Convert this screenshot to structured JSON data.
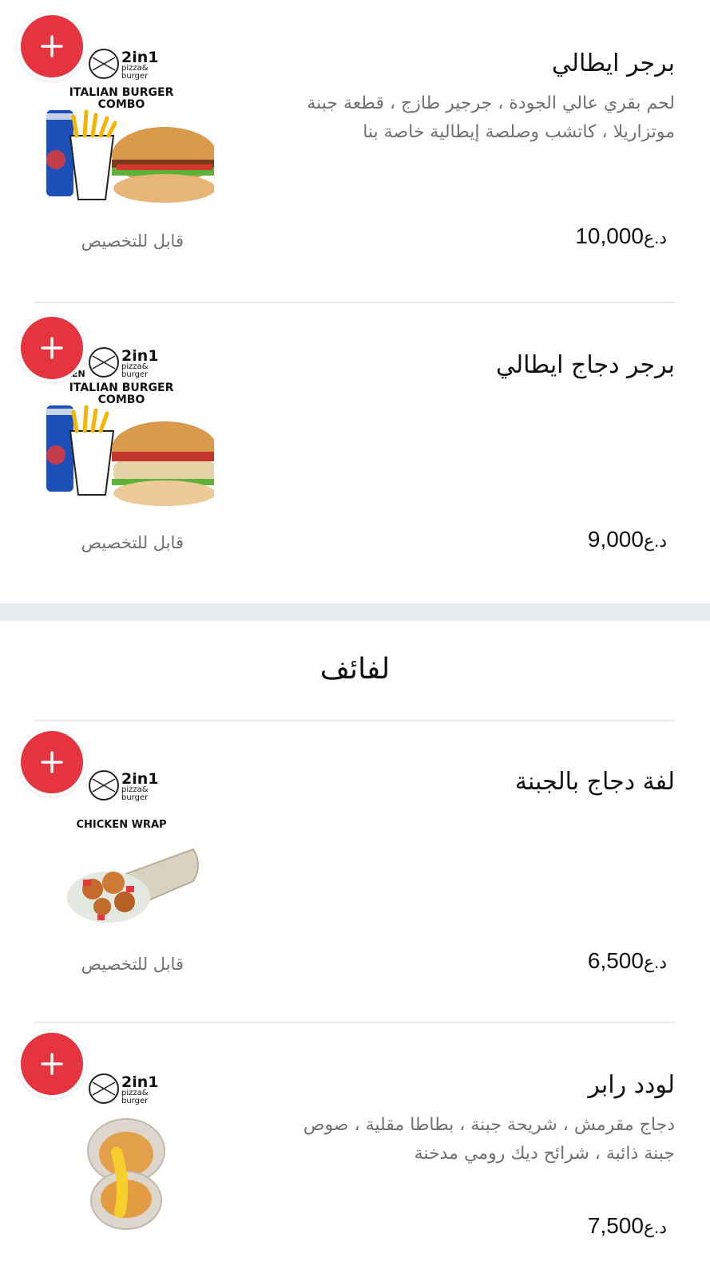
{
  "items": [
    {
      "name": "برجر ايطالي",
      "description": "لحم بقري عالي الجودة ، جرجير طازج ، قطعة جبنة موتزاريلا ، كاتشب وصلصة إيطالية خاصة بنا",
      "price": "10,000",
      "currency": "د.ع",
      "customizable": "قابل للتخصيص",
      "image": {
        "brand": "2in1",
        "brand_sub1": "pizza&",
        "brand_sub2": "burger",
        "caption1": "ITALIAN BURGER",
        "caption2": "COMBO"
      }
    },
    {
      "name": "برجر دجاج ايطالي",
      "description": "",
      "price": "9,000",
      "currency": "د.ع",
      "customizable": "قابل للتخصيص",
      "image": {
        "brand": "2in1",
        "brand_sub1": "pizza&",
        "brand_sub2": "burger",
        "tag": "CHICKEN",
        "caption1": "ITALIAN BURGER",
        "caption2": "COMBO"
      }
    },
    {
      "name": "لفة دجاج بالجبنة",
      "description": "",
      "price": "6,500",
      "currency": "د.ع",
      "customizable": "قابل للتخصيص",
      "image": {
        "brand": "2in1",
        "brand_sub1": "pizza&",
        "brand_sub2": "burger",
        "caption1": "CHICKEN WRAP"
      }
    },
    {
      "name": "لودد رابر",
      "description": "دجاج مقرمش ، شريحة جبنة ، بطاطا مقلية ، صوص جبنة ذائبة ، شرائح ديك رومي مدخنة",
      "price": "7,500",
      "currency": "د.ع",
      "customizable": "",
      "image": {
        "brand": "2in1",
        "brand_sub1": "pizza&",
        "brand_sub2": "burger"
      }
    }
  ],
  "section": {
    "title": "لفائف"
  },
  "colors": {
    "accent": "#e5343f",
    "divider": "#e6e8ea",
    "band": "#e9ecef"
  },
  "icons": {
    "add": "plus-icon"
  }
}
